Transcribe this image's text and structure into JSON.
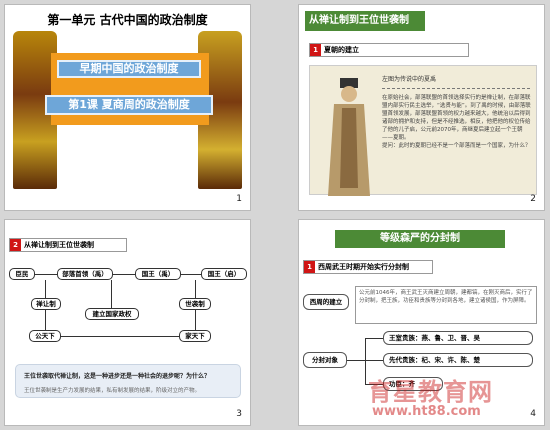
{
  "slides": [
    {
      "number": "1",
      "title": "第一单元  古代中国的政治制度",
      "box_a": "早期中国的政治制度",
      "box_b": "第1课 夏商周的政治制度"
    },
    {
      "number": "2",
      "header": "从禅让制到王位世袭制",
      "section_no": "1",
      "section_label": "夏朝的建立",
      "caption": "左图为传说中的夏禹",
      "body": "在原始社会，部落联盟的首领选择实行的是禅让制，在部落联盟内部实行民主选举，“选贤与能”。到了禹的时候，由部落联盟首领发展，部落联盟首领的权力越来越大，他统治以后得到诸部的拥护和支持，但是不经推选，相反，他把他的权位传给了他的儿子启，公元前2070年，商继夏后建立起一个王朝——夏朝。",
      "question": "提问：此时的夏朝已经不是一个部落而是一个国家，为什么？"
    },
    {
      "number": "3",
      "section_no": "2",
      "section_label": "从禅让制到王位世袭制",
      "nodes": {
        "a": "臣民",
        "b": "部落首领（禹）",
        "c": "国王（禹）",
        "d": "国王（启）",
        "e": "禅让制",
        "f": "建立国家政权",
        "g": "世袭制",
        "h": "公天下",
        "i": "家天下"
      },
      "q1": "王位世袭取代禅让制，这是一种进步还是一种社会的退步呢？为什么？",
      "q2": "王位世袭制是生产力发展的结果，私有制发展的结果，阶级对立的产物。"
    },
    {
      "number": "4",
      "header": "等级森严的分封制",
      "section_no": "1",
      "section_label": "西周武王时期开始实行分封制",
      "left1": "西周的建立",
      "desc": "公元前1046年，商王武王灭商建立周朝，建都镐，在刚灭商后，实行了分封制，把王族，功臣和贵族等分封到各地，建立诸侯国，作为屏障。",
      "left2": "分封对象",
      "sub1": "王室贵族：燕、鲁、卫、晋、吴",
      "sub2": "先代贵族：杞、宋、许、陈、楚",
      "sub3": "功臣：齐"
    }
  ],
  "watermark": "育星教育网",
  "watermark_url": "www.ht88.com"
}
